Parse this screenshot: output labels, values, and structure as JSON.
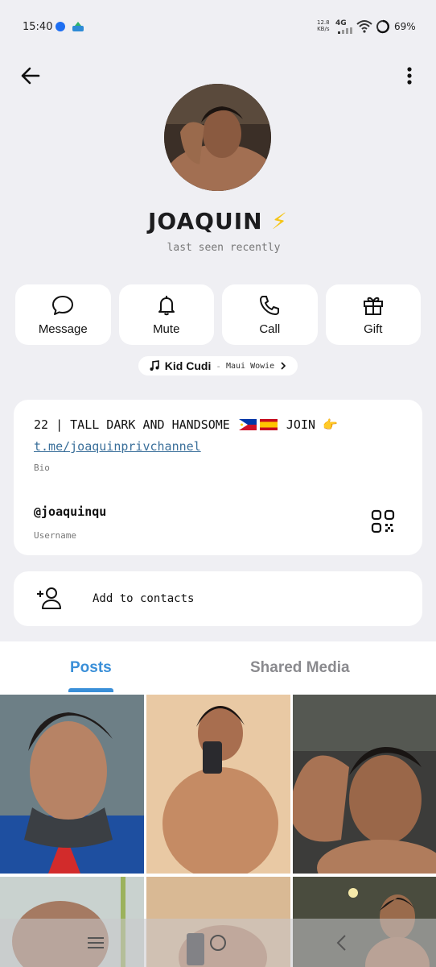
{
  "status_bar": {
    "time": "15:40",
    "speed_value": "12.8",
    "speed_unit": "KB/s",
    "network": "4G",
    "battery": "69%"
  },
  "profile": {
    "name": "JOAQUIN",
    "name_emoji": "⚡",
    "last_seen": "last seen recently"
  },
  "actions": [
    {
      "label": "Message",
      "icon": "message-bubble-icon"
    },
    {
      "label": "Mute",
      "icon": "bell-icon"
    },
    {
      "label": "Call",
      "icon": "phone-icon"
    },
    {
      "label": "Gift",
      "icon": "gift-icon"
    }
  ],
  "music": {
    "artist": "Kid Cudi",
    "separator": "-",
    "song": "Maui Wowie"
  },
  "info": {
    "bio_text": "22 | TALL DARK AND HANDSOME",
    "bio_join": "JOIN",
    "bio_link": "t.me/joaquinprivchannel",
    "bio_caption": "Bio",
    "username": "@joaquinqu",
    "username_caption": "Username"
  },
  "contact": {
    "label": "Add to contacts"
  },
  "tabs": [
    {
      "label": "Posts",
      "active": true
    },
    {
      "label": "Shared Media",
      "active": false
    }
  ],
  "colors": {
    "accent": "#3a8fd8",
    "background": "#efeff3",
    "card": "#ffffff"
  }
}
